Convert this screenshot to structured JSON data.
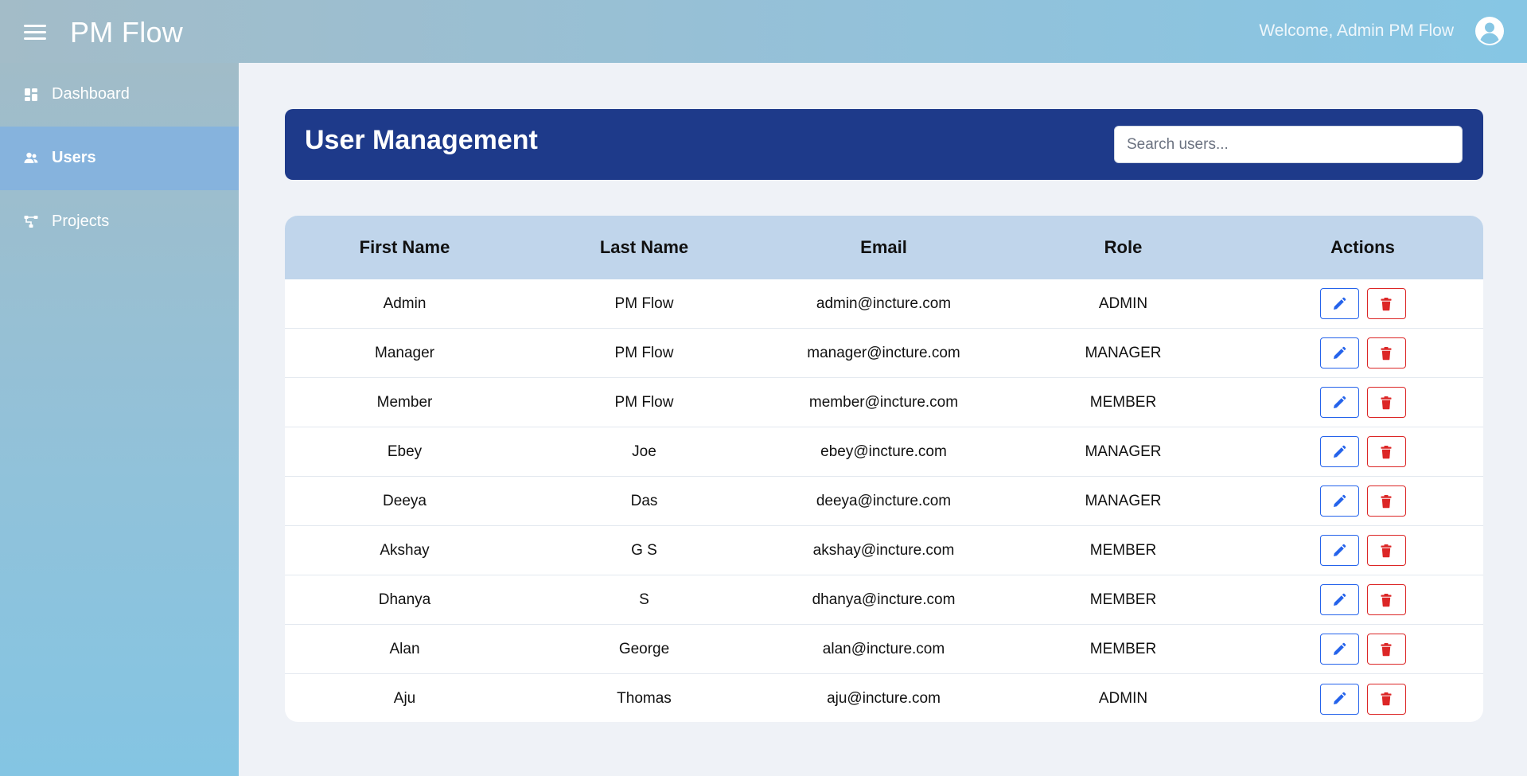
{
  "app": {
    "brand": "PM Flow",
    "welcome": "Welcome, Admin PM Flow",
    "colors": {
      "accent": "#1e3a8a",
      "edit": "#2563eb",
      "delete": "#dc2626",
      "table_header": "#c0d5eb"
    }
  },
  "sidebar": {
    "items": [
      {
        "label": "Dashboard",
        "icon": "dashboard-icon"
      },
      {
        "label": "Users",
        "icon": "users-icon",
        "active": true
      },
      {
        "label": "Projects",
        "icon": "projects-icon"
      }
    ]
  },
  "main": {
    "title": "User Management",
    "search": {
      "placeholder": "Search users...",
      "value": ""
    }
  },
  "table": {
    "columns": [
      "First Name",
      "Last Name",
      "Email",
      "Role",
      "Actions"
    ],
    "rows": [
      {
        "first": "Admin",
        "last": "PM Flow",
        "email": "admin@incture.com",
        "role": "ADMIN"
      },
      {
        "first": "Manager",
        "last": "PM Flow",
        "email": "manager@incture.com",
        "role": "MANAGER"
      },
      {
        "first": "Member",
        "last": "PM Flow",
        "email": "member@incture.com",
        "role": "MEMBER"
      },
      {
        "first": "Ebey",
        "last": "Joe",
        "email": "ebey@incture.com",
        "role": "MANAGER"
      },
      {
        "first": "Deeya",
        "last": "Das",
        "email": "deeya@incture.com",
        "role": "MANAGER"
      },
      {
        "first": "Akshay",
        "last": "G S",
        "email": "akshay@incture.com",
        "role": "MEMBER"
      },
      {
        "first": "Dhanya",
        "last": "S",
        "email": "dhanya@incture.com",
        "role": "MEMBER"
      },
      {
        "first": "Alan",
        "last": "George",
        "email": "alan@incture.com",
        "role": "MEMBER"
      },
      {
        "first": "Aju",
        "last": "Thomas",
        "email": "aju@incture.com",
        "role": "ADMIN"
      }
    ],
    "row_actions": [
      "pencil-icon",
      "trash-icon"
    ]
  }
}
